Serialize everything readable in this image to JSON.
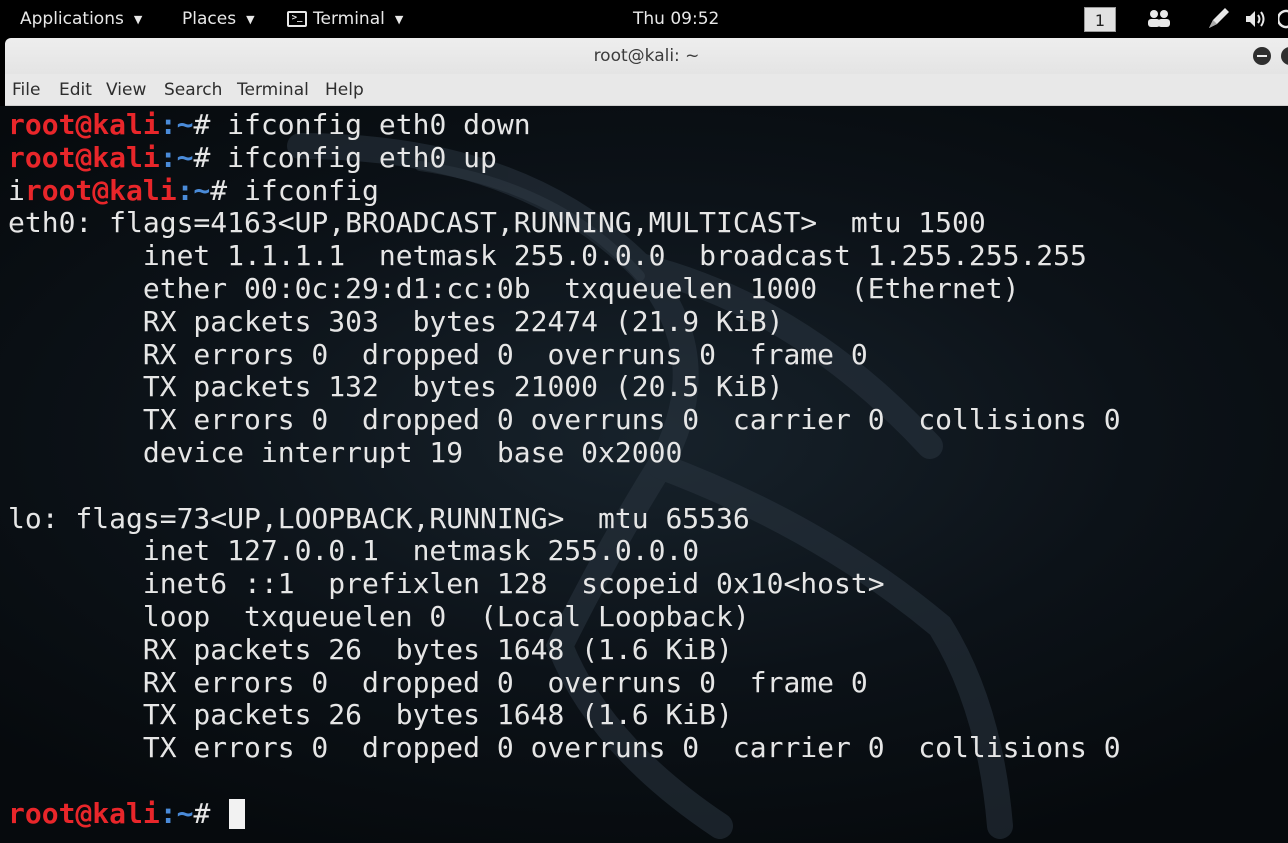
{
  "top_panel": {
    "applications": "Applications",
    "places": "Places",
    "terminal": "Terminal",
    "clock": "Thu 09:52",
    "workspace": "1"
  },
  "window": {
    "title": "root@kali: ~"
  },
  "menubar": {
    "items": [
      "File",
      "Edit",
      "View",
      "Search",
      "Terminal",
      "Help"
    ]
  },
  "terminal": {
    "prompt": {
      "user": "root@kali",
      "path": ":~",
      "symbol": "# "
    },
    "lines": [
      {
        "type": "prompt",
        "pre": "",
        "cmd": "ifconfig eth0 down"
      },
      {
        "type": "prompt",
        "pre": "",
        "cmd": "ifconfig eth0 up"
      },
      {
        "type": "prompt",
        "pre": "i",
        "cmd": "ifconfig"
      },
      {
        "type": "output",
        "text": "eth0: flags=4163<UP,BROADCAST,RUNNING,MULTICAST>  mtu 1500"
      },
      {
        "type": "output",
        "text": "        inet 1.1.1.1  netmask 255.0.0.0  broadcast 1.255.255.255"
      },
      {
        "type": "output",
        "text": "        ether 00:0c:29:d1:cc:0b  txqueuelen 1000  (Ethernet)"
      },
      {
        "type": "output",
        "text": "        RX packets 303  bytes 22474 (21.9 KiB)"
      },
      {
        "type": "output",
        "text": "        RX errors 0  dropped 0  overruns 0  frame 0"
      },
      {
        "type": "output",
        "text": "        TX packets 132  bytes 21000 (20.5 KiB)"
      },
      {
        "type": "output",
        "text": "        TX errors 0  dropped 0 overruns 0  carrier 0  collisions 0"
      },
      {
        "type": "output",
        "text": "        device interrupt 19  base 0x2000"
      },
      {
        "type": "output",
        "text": ""
      },
      {
        "type": "output",
        "text": "lo: flags=73<UP,LOOPBACK,RUNNING>  mtu 65536"
      },
      {
        "type": "output",
        "text": "        inet 127.0.0.1  netmask 255.0.0.0"
      },
      {
        "type": "output",
        "text": "        inet6 ::1  prefixlen 128  scopeid 0x10<host>"
      },
      {
        "type": "output",
        "text": "        loop  txqueuelen 0  (Local Loopback)"
      },
      {
        "type": "output",
        "text": "        RX packets 26  bytes 1648 (1.6 KiB)"
      },
      {
        "type": "output",
        "text": "        RX errors 0  dropped 0  overruns 0  frame 0"
      },
      {
        "type": "output",
        "text": "        TX packets 26  bytes 1648 (1.6 KiB)"
      },
      {
        "type": "output",
        "text": "        TX errors 0  dropped 0 overruns 0  carrier 0  collisions 0"
      },
      {
        "type": "output",
        "text": ""
      },
      {
        "type": "prompt",
        "pre": "",
        "cmd": "",
        "cursor": true
      }
    ]
  }
}
